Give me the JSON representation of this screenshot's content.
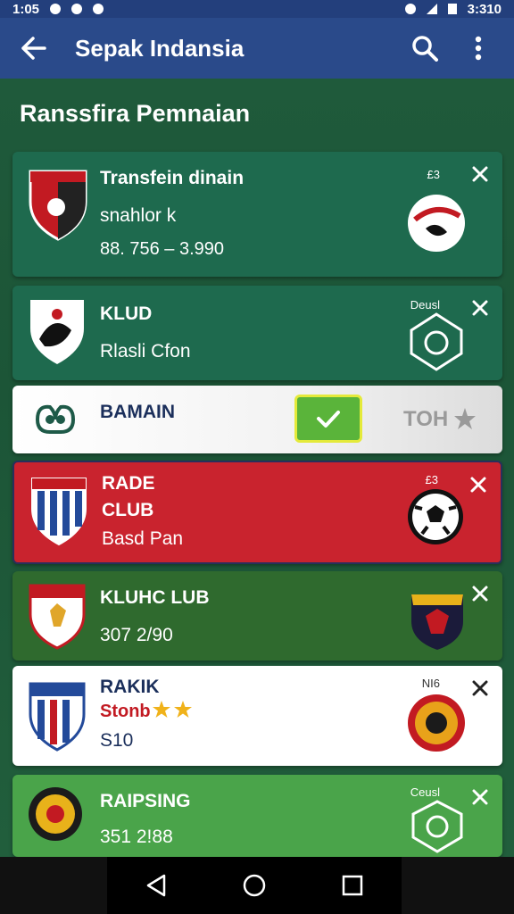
{
  "status": {
    "time_left": "1:05",
    "time_right": "3:310"
  },
  "app_bar": {
    "title": "Sepak Indansia"
  },
  "section": {
    "title": "Ranssfira Pemnaian"
  },
  "cards": [
    {
      "line1": "Transfein dinain",
      "line2": "snahlor k",
      "line3": "88. 756 – 3.990",
      "tag": "£3"
    },
    {
      "line1": "KLUD",
      "line2": "Rlasli Cfon",
      "tag": "Deusl"
    },
    {
      "line1": "BAMAIN",
      "right_text": "TOH"
    },
    {
      "line1": "RADE",
      "line2": "CLUB",
      "line3": "Basd Pan",
      "tag": "£3"
    },
    {
      "line1": "KLUHC LUB",
      "line2": "307 2/90"
    },
    {
      "line1": "RAKIK",
      "line2": "Stonb",
      "line3": "S10",
      "tag": "NI6"
    },
    {
      "line1": "RAIPSING",
      "line2": "351 2!88",
      "tag": "Ceusl"
    }
  ],
  "colors": {
    "app_bar": "#2a4a8a",
    "card_green": "#1e6a4e",
    "card_red": "#c9232e",
    "card_lightgreen": "#2f6a2e",
    "card_bright_green": "#4aa44a",
    "card_white": "#ffffff",
    "checkbox_green": "#5ab43a"
  }
}
